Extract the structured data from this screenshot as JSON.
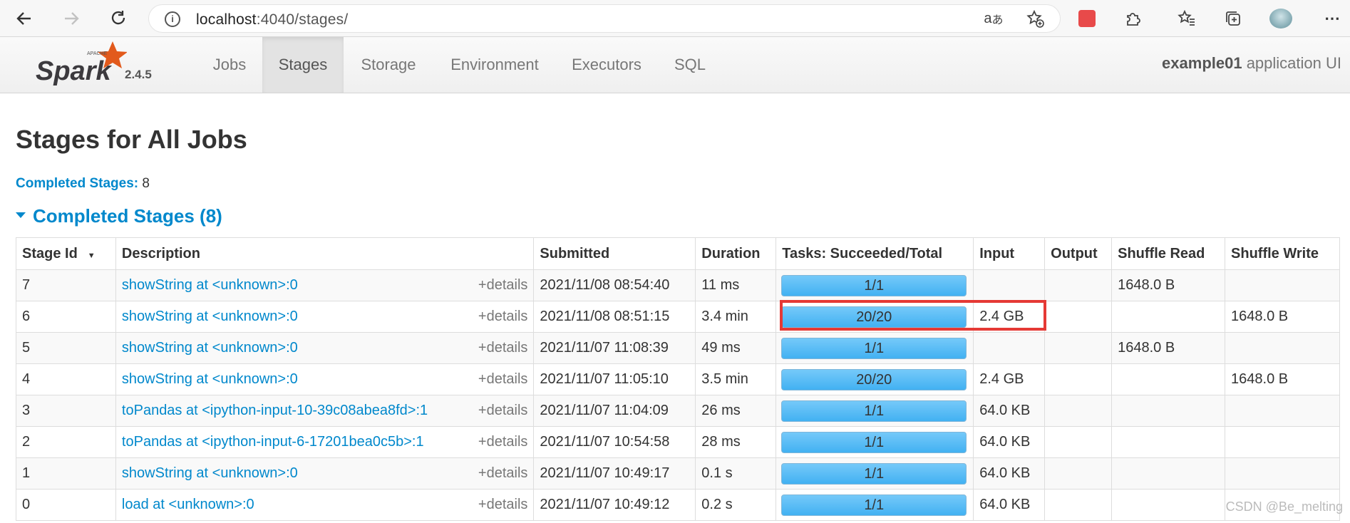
{
  "browser": {
    "url_host": "localhost",
    "url_path": ":4040/stages/"
  },
  "spark": {
    "logo_small_text": "APACHE",
    "logo_text": "Spark",
    "version": "2.4.5",
    "tabs": [
      {
        "label": "Jobs",
        "active": false
      },
      {
        "label": "Stages",
        "active": true
      },
      {
        "label": "Storage",
        "active": false
      },
      {
        "label": "Environment",
        "active": false
      },
      {
        "label": "Executors",
        "active": false
      },
      {
        "label": "SQL",
        "active": false
      }
    ],
    "app_name": "example01",
    "app_suffix": " application UI"
  },
  "page": {
    "title": "Stages for All Jobs",
    "summary_label": "Completed Stages:",
    "summary_value": " 8",
    "section_heading": "Completed Stages (8)"
  },
  "table": {
    "columns": [
      "Stage Id",
      "Description",
      "Submitted",
      "Duration",
      "Tasks: Succeeded/Total",
      "Input",
      "Output",
      "Shuffle Read",
      "Shuffle Write"
    ],
    "details_label": "+details",
    "rows": [
      {
        "id": "7",
        "desc": "showString at <unknown>:0",
        "submitted": "2021/11/08 08:54:40",
        "duration": "11 ms",
        "tasks": "1/1",
        "input": "",
        "output": "",
        "shuffle_read": "1648.0 B",
        "shuffle_write": ""
      },
      {
        "id": "6",
        "desc": "showString at <unknown>:0",
        "submitted": "2021/11/08 08:51:15",
        "duration": "3.4 min",
        "tasks": "20/20",
        "input": "2.4 GB",
        "output": "",
        "shuffle_read": "",
        "shuffle_write": "1648.0 B"
      },
      {
        "id": "5",
        "desc": "showString at <unknown>:0",
        "submitted": "2021/11/07 11:08:39",
        "duration": "49 ms",
        "tasks": "1/1",
        "input": "",
        "output": "",
        "shuffle_read": "1648.0 B",
        "shuffle_write": ""
      },
      {
        "id": "4",
        "desc": "showString at <unknown>:0",
        "submitted": "2021/11/07 11:05:10",
        "duration": "3.5 min",
        "tasks": "20/20",
        "input": "2.4 GB",
        "output": "",
        "shuffle_read": "",
        "shuffle_write": "1648.0 B"
      },
      {
        "id": "3",
        "desc": "toPandas at <ipython-input-10-39c08abea8fd>:1",
        "submitted": "2021/11/07 11:04:09",
        "duration": "26 ms",
        "tasks": "1/1",
        "input": "64.0 KB",
        "output": "",
        "shuffle_read": "",
        "shuffle_write": ""
      },
      {
        "id": "2",
        "desc": "toPandas at <ipython-input-6-17201bea0c5b>:1",
        "submitted": "2021/11/07 10:54:58",
        "duration": "28 ms",
        "tasks": "1/1",
        "input": "64.0 KB",
        "output": "",
        "shuffle_read": "",
        "shuffle_write": ""
      },
      {
        "id": "1",
        "desc": "showString at <unknown>:0",
        "submitted": "2021/11/07 10:49:17",
        "duration": "0.1 s",
        "tasks": "1/1",
        "input": "64.0 KB",
        "output": "",
        "shuffle_read": "",
        "shuffle_write": ""
      },
      {
        "id": "0",
        "desc": "load at <unknown>:0",
        "submitted": "2021/11/07 10:49:12",
        "duration": "0.2 s",
        "tasks": "1/1",
        "input": "64.0 KB",
        "output": "",
        "shuffle_read": "",
        "shuffle_write": ""
      }
    ]
  },
  "watermark": "CSDN @Be_melting",
  "colors": {
    "link": "#0088cc",
    "progress": "#42b1f2",
    "highlight": "#e53935"
  }
}
